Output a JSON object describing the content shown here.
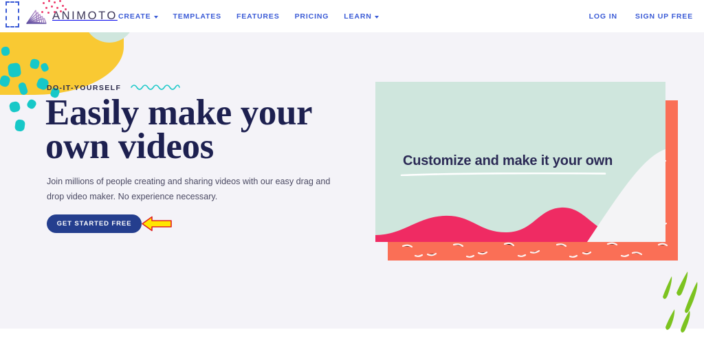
{
  "brand": {
    "name": "ANIMOTO",
    "logo_icon": "animoto-fan-logo-icon",
    "accent_blue": "#3b5bd6",
    "cta_blue": "#243e8e",
    "headline_navy": "#1d2050",
    "teal": "#17c8c8",
    "yellow": "#f9c933",
    "coral": "#fa6f56",
    "mint": "#cfe6dd",
    "pink": "#ee3d6e",
    "green": "#7cc320",
    "hero_background": "#f4f3f8"
  },
  "nav": {
    "links": [
      {
        "label": "CREATE",
        "has_dropdown": true
      },
      {
        "label": "TEMPLATES",
        "has_dropdown": false
      },
      {
        "label": "FEATURES",
        "has_dropdown": false
      },
      {
        "label": "PRICING",
        "has_dropdown": false
      },
      {
        "label": "LEARN",
        "has_dropdown": true
      }
    ],
    "login_label": "LOG IN",
    "signup_label": "SIGN UP FREE"
  },
  "hero": {
    "eyebrow": "DO-IT-YOURSELF",
    "headline_line1": "Easily make your",
    "headline_line2": "own videos",
    "subcopy": "Join millions of people creating and sharing videos with our easy drag and drop video maker. No experience necessary.",
    "cta_label": "GET STARTED FREE"
  },
  "artwork": {
    "card_text": "Customize and make it your own"
  },
  "annotation": {
    "arrow_fill": "#ffe600",
    "arrow_stroke": "#e02020",
    "arrow_direction": "left",
    "points_at": "GET STARTED FREE"
  }
}
